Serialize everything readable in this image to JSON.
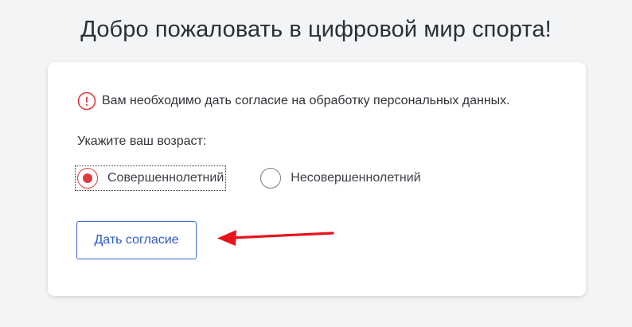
{
  "page": {
    "title": "Добро пожаловать в цифровой мир спорта!"
  },
  "notice": {
    "text": "Вам необходимо дать согласие на обработку персональных данных.",
    "icon": "alert-circle-icon",
    "color": "#e03a3e"
  },
  "age": {
    "label": "Укажите ваш возраст:",
    "options": [
      {
        "label": "Совершеннолетний",
        "selected": true
      },
      {
        "label": "Несовершеннолетний",
        "selected": false
      }
    ]
  },
  "consent": {
    "button_label": "Дать согласие"
  },
  "colors": {
    "accent_red": "#e03a3e",
    "button_blue": "#2d5bc9",
    "background": "#f3f4f6"
  }
}
